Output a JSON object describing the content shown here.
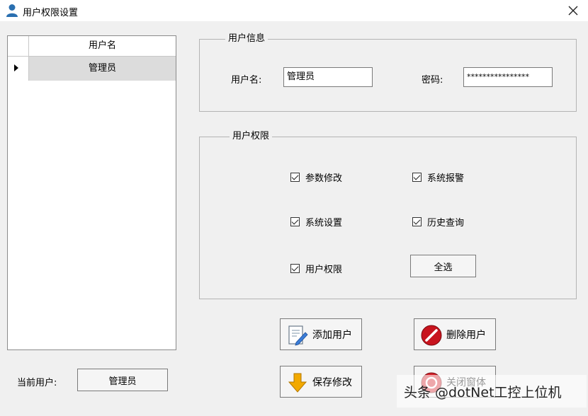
{
  "window": {
    "title": "用户权限设置",
    "icon": "user-icon"
  },
  "grid": {
    "column_header": "用户名",
    "rows": [
      {
        "username": "管理员"
      }
    ]
  },
  "user_info": {
    "legend": "用户信息",
    "username_label": "用户名:",
    "username_value": "管理员",
    "password_label": "密码:",
    "password_value": "****************"
  },
  "permissions": {
    "legend": "用户权限",
    "items": [
      {
        "label": "参数修改",
        "checked": true
      },
      {
        "label": "系统报警",
        "checked": true
      },
      {
        "label": "系统设置",
        "checked": true
      },
      {
        "label": "历史查询",
        "checked": true
      },
      {
        "label": "用户权限",
        "checked": true
      }
    ],
    "select_all_label": "全选"
  },
  "actions": {
    "add_user": "添加用户",
    "delete_user": "删除用户",
    "save_changes": "保存修改",
    "close_window": "关闭窗体"
  },
  "current_user": {
    "label": "当前用户:",
    "value": "管理员"
  },
  "watermark": {
    "text": "头条 @dotNet工控上位机"
  },
  "colors": {
    "title_icon": "#2a6fb0",
    "delete_red": "#c8141e",
    "save_yellow": "#f2a900"
  }
}
